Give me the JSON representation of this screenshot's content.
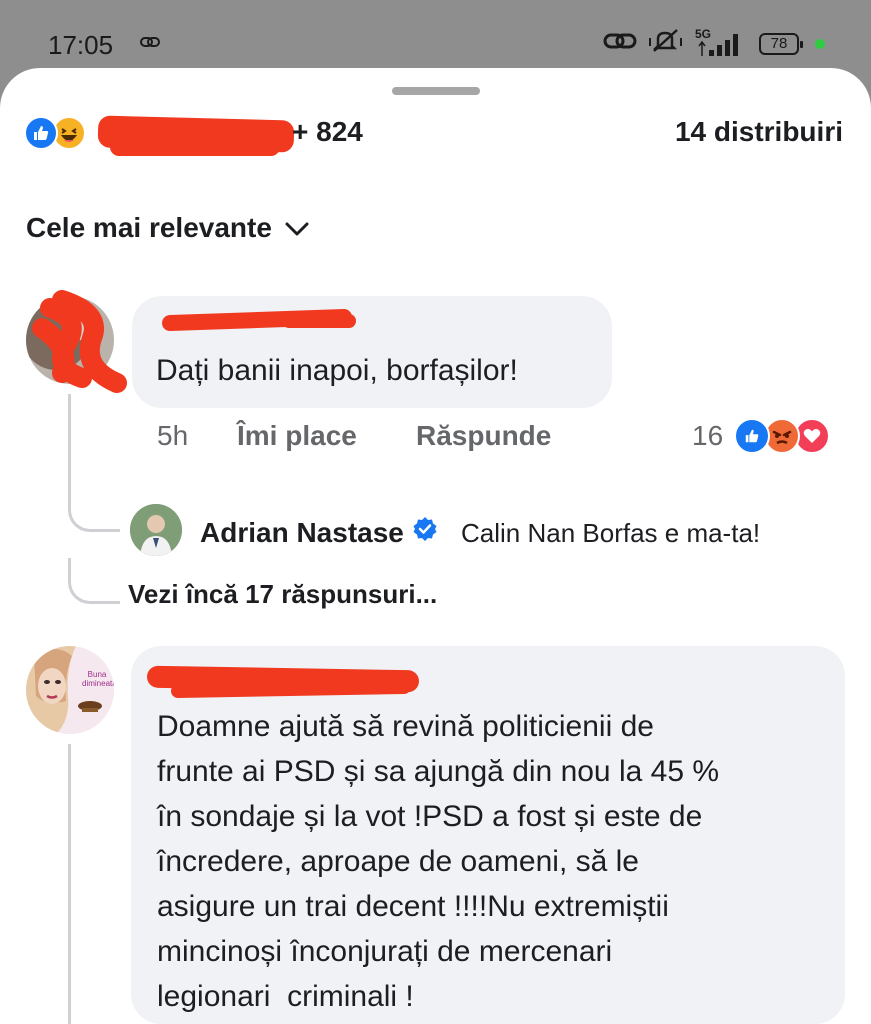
{
  "status_bar": {
    "time": "17:05",
    "network": "5G",
    "battery": "78"
  },
  "header": {
    "reaction_count": "+ 824",
    "shares": "14 distribuiri"
  },
  "sort": {
    "label": "Cele mai relevante"
  },
  "comments": [
    {
      "text": "Dați banii inapoi, borfașilor!",
      "time": "5h",
      "like_label": "Îmi place",
      "reply_label": "Răspunde",
      "reaction_count": "16",
      "reply": {
        "author": "Adrian Nastase",
        "text": "Calin Nan Borfas e ma-ta!"
      },
      "more_replies": "Vezi încă 17 răspunsuri..."
    },
    {
      "avatar_text": "Buna dimineata",
      "text_lines": [
        "Doamne ajută să revină politicienii de",
        "frunte ai PSD și sa ajungă din nou la 45 %",
        "în sondaje și la vot !PSD a fost și este de",
        "încredere, aproape de oameni, să le",
        "asigure un trai decent !!!!Nu extremiștii",
        "mincinoși înconjurați de mercenari",
        "legionari  criminali !"
      ]
    }
  ],
  "colors": {
    "like_blue": "#1877f2",
    "redaction_red": "#f0391f",
    "bubble_gray": "#f0f2f5"
  }
}
